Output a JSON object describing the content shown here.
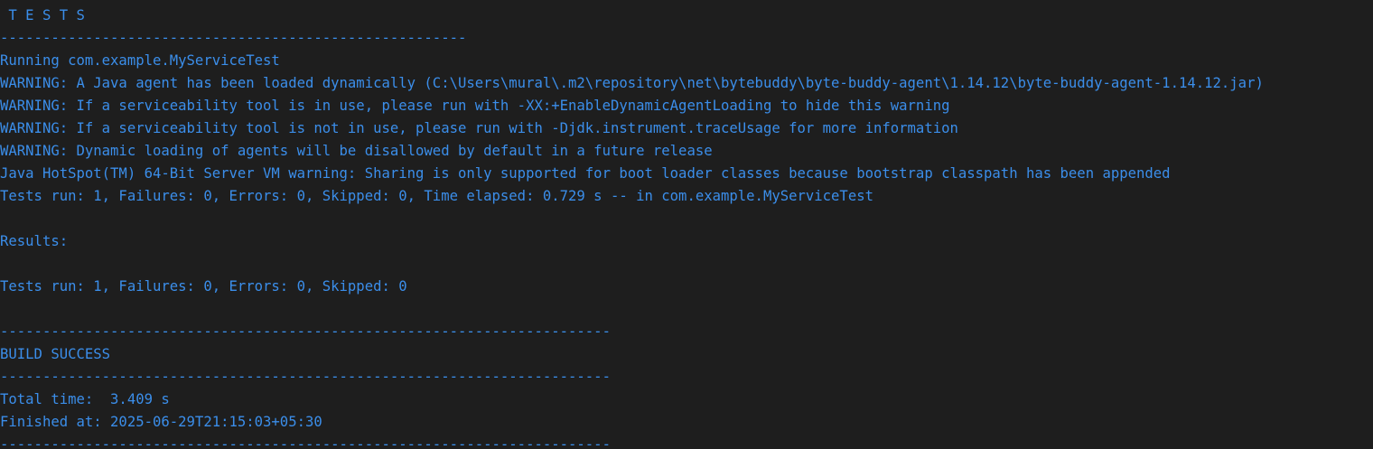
{
  "terminal": {
    "text_color": "#3b8eea",
    "background": "#1e1e1e",
    "lines": [
      " T E S T S",
      "-------------------------------------------------------",
      "Running com.example.MyServiceTest",
      "WARNING: A Java agent has been loaded dynamically (C:\\Users\\mural\\.m2\\repository\\net\\bytebuddy\\byte-buddy-agent\\1.14.12\\byte-buddy-agent-1.14.12.jar)",
      "WARNING: If a serviceability tool is in use, please run with -XX:+EnableDynamicAgentLoading to hide this warning",
      "WARNING: If a serviceability tool is not in use, please run with -Djdk.instrument.traceUsage for more information",
      "WARNING: Dynamic loading of agents will be disallowed by default in a future release",
      "Java HotSpot(TM) 64-Bit Server VM warning: Sharing is only supported for boot loader classes because bootstrap classpath has been appended",
      "Tests run: 1, Failures: 0, Errors: 0, Skipped: 0, Time elapsed: 0.729 s -- in com.example.MyServiceTest",
      "",
      "Results:",
      "",
      "Tests run: 1, Failures: 0, Errors: 0, Skipped: 0",
      "",
      "------------------------------------------------------------------------",
      "BUILD SUCCESS",
      "------------------------------------------------------------------------",
      "Total time:  3.409 s",
      "Finished at: 2025-06-29T21:15:03+05:30",
      "------------------------------------------------------------------------"
    ]
  }
}
